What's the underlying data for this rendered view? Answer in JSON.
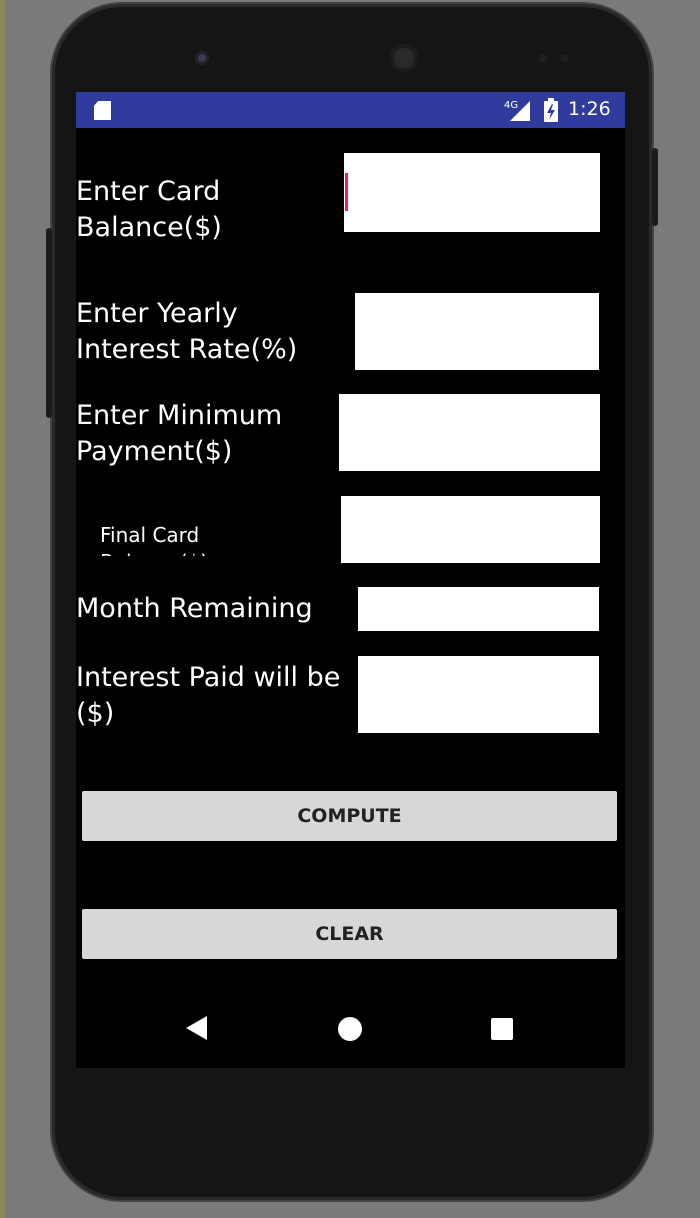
{
  "status_bar": {
    "network_label": "4G",
    "time": "1:26",
    "icons": [
      "sd-card-icon",
      "signal-icon",
      "battery-charging-icon"
    ]
  },
  "form": {
    "card_balance_label": "Enter Card Balance($)",
    "card_balance_value": "",
    "interest_rate_label": "Enter Yearly Interest Rate(%)",
    "interest_rate_value": "",
    "min_payment_label": "Enter Minimum Payment($)",
    "min_payment_value": "",
    "final_balance_label": "Final Card Balance($)",
    "final_balance_value": "",
    "months_remaining_label": "Month Remaining",
    "months_remaining_value": "",
    "interest_paid_label": "Interest Paid will be ($)",
    "interest_paid_value": ""
  },
  "buttons": {
    "compute_label": "COMPUTE",
    "clear_label": "CLEAR"
  },
  "nav": {
    "icons": [
      "back-icon",
      "home-icon",
      "recents-icon"
    ]
  },
  "colors": {
    "status_bar": "#2f3c9e",
    "cursor": "#e91e63",
    "button_bg": "#d6d7d7"
  }
}
